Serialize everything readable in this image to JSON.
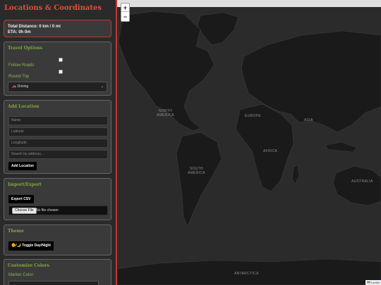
{
  "sidebar": {
    "title": "Locations & Coordinates",
    "distance": {
      "total": "Total Distance: 0 km / 0 mi",
      "eta": "ETA: 0h 0m"
    },
    "travel_options": {
      "title": "Travel Options",
      "follow_roads_label": "Follow Roads",
      "follow_roads_checked": false,
      "round_trip_label": "Round Trip",
      "round_trip_checked": false,
      "mode_selected": "🚗 Driving"
    },
    "add_location": {
      "title": "Add Location",
      "name_placeholder": "Name",
      "latitude_placeholder": "Latitude",
      "longitude_placeholder": "Longitude",
      "search_placeholder": "Search by address...",
      "add_button": "Add Location"
    },
    "import_export": {
      "title": "Import/Export",
      "export_button": "Export CSV",
      "choose_file_button": "Choose File",
      "file_status": "No file chosen"
    },
    "theme": {
      "title": "Theme",
      "toggle_button": "🌞/🌙 Toggle Day/Night"
    },
    "customize_colors": {
      "title": "Customize Colors",
      "marker_color_label": "Marker Color:"
    }
  },
  "map": {
    "zoom_in": "+",
    "zoom_out": "−",
    "attribution": "Leaflet",
    "labels": {
      "north_america": "NORTH\nAMERICA",
      "europe": "EUROPE",
      "asia": "ASIA",
      "africa": "AFRICA",
      "south_america": "SOUTH\nAMERICA",
      "australia": "AUSTRALIA",
      "antarctica": "ANTARCTICA"
    },
    "colors": {
      "land": "#1a1a1a",
      "water": "#2b2b2b"
    }
  },
  "colors": {
    "accent": "#e74c3c",
    "section_title": "#7fa93a",
    "panel": "#3a3a3a"
  }
}
